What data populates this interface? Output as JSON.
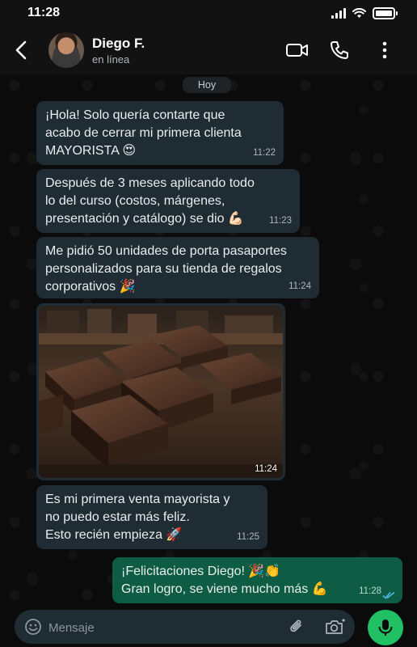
{
  "status_bar": {
    "time": "11:28"
  },
  "header": {
    "contact_name": "Diego F.",
    "contact_status": "en línea"
  },
  "day_label": "Hoy",
  "messages": [
    {
      "direction": "in",
      "lines": [
        "¡Hola! Solo quería contarte que",
        "acabo de cerrar mi primera clienta",
        "MAYORISTA 😍"
      ],
      "time": "11:22"
    },
    {
      "direction": "in",
      "lines": [
        "Después de 3 meses aplicando todo",
        "lo del curso (costos, márgenes,",
        "presentación y catálogo) se dio 💪🏻"
      ],
      "time": "11:23"
    },
    {
      "direction": "in",
      "lines": [
        "Me pidió 50 unidades de porta pasaportes",
        "personalizados para su tienda de regalos",
        "corporativos 🎉"
      ],
      "time": "11:24"
    },
    {
      "direction": "in",
      "type": "image",
      "time": "11:24"
    },
    {
      "direction": "in",
      "lines": [
        "Es mi primera venta mayorista y",
        "no puedo estar más feliz.",
        "Esto recién empieza 🚀"
      ],
      "time": "11:25"
    },
    {
      "direction": "out",
      "lines": [
        "¡Felicitaciones Diego! 🎉👏",
        "Gran logro, se viene mucho más 💪"
      ],
      "time": "11:28"
    }
  ],
  "composer": {
    "placeholder": "Mensaje"
  },
  "colors": {
    "incoming_bubble": "#202c33",
    "outgoing_bubble": "#0d5c43",
    "mic_button": "#21c063",
    "read_ticks": "#53bdeb"
  },
  "icons": [
    "back-arrow-icon",
    "video-call-icon",
    "phone-icon",
    "more-options-icon",
    "emoji-icon",
    "attach-clip-icon",
    "camera-icon",
    "mic-icon",
    "double-check-icon"
  ]
}
